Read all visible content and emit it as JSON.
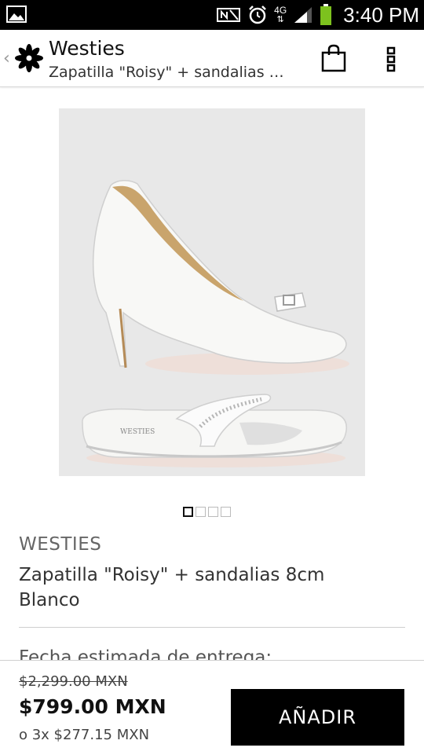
{
  "status_bar": {
    "time": "3:40 PM",
    "network": "4G",
    "battery_color": "#7dc21e"
  },
  "app_bar": {
    "title": "Westies",
    "subtitle": "Zapatilla \"Roisy\" + sandalias 8cm Blanco",
    "icons": [
      "flower-logo-icon",
      "shopping-bag-icon",
      "overflow-menu-icon"
    ]
  },
  "product": {
    "image_pager": {
      "count": 4,
      "active_index": 0
    },
    "brand": "WESTIES",
    "name": "Zapatilla \"Roisy\" + sandalias 8cm Blanco",
    "delivery_label": "Fecha estimada de entrega:"
  },
  "purchase": {
    "original_price": "$2,299.00 MXN",
    "sale_price": "$799.00 MXN",
    "installments": "o 3x $277.15 MXN",
    "add_button_label": "AÑADIR"
  }
}
